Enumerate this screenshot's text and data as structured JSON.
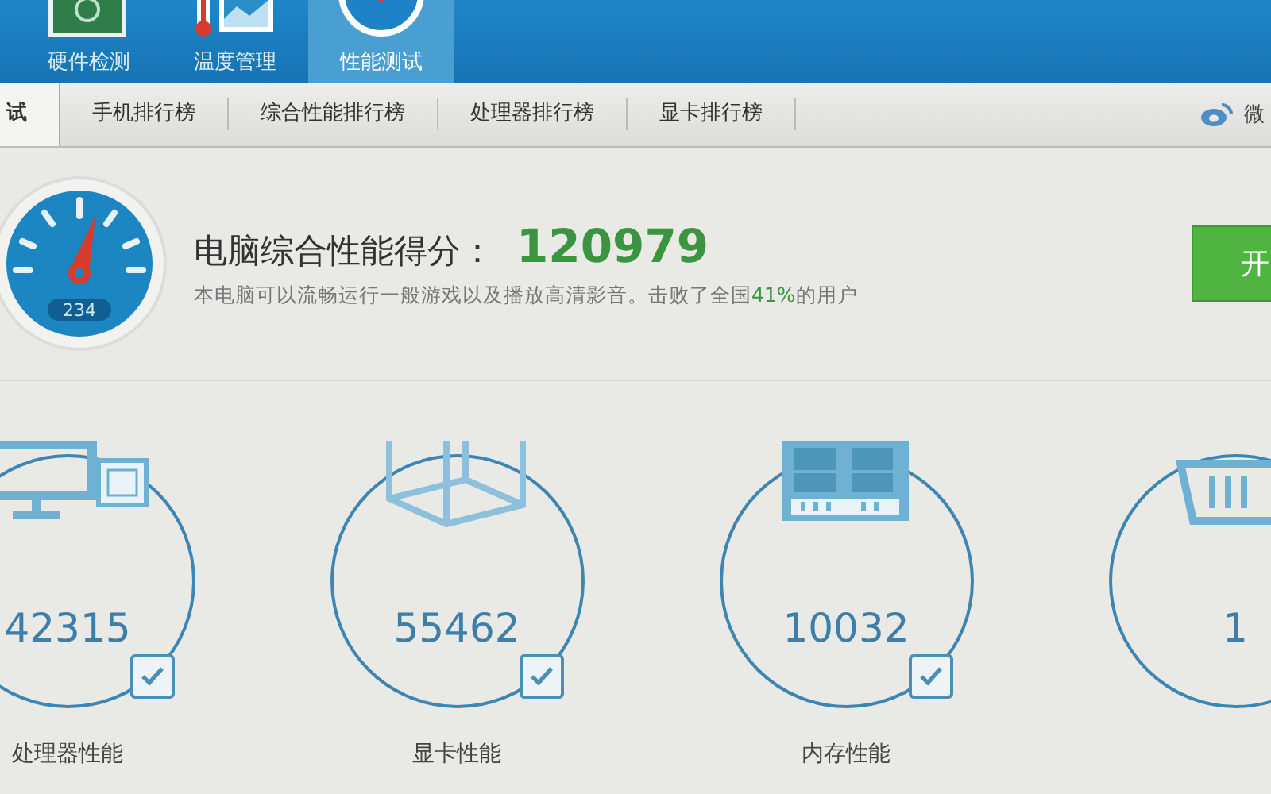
{
  "nav": [
    {
      "label": "硬件检测",
      "kind": "board",
      "selected": false
    },
    {
      "label": "温度管理",
      "kind": "thermo",
      "selected": false
    },
    {
      "label": "性能测试",
      "kind": "gauge",
      "selected": true
    }
  ],
  "tabs": [
    {
      "label": "试",
      "selected": true
    },
    {
      "label": "手机排行榜",
      "selected": false
    },
    {
      "label": "综合性能排行榜",
      "selected": false
    },
    {
      "label": "处理器排行榜",
      "selected": false
    },
    {
      "label": "显卡排行榜",
      "selected": false
    }
  ],
  "share": {
    "label": "微"
  },
  "score": {
    "gauge_reading": "234",
    "title": "电脑综合性能得分：",
    "value": "120979",
    "description": "本电脑可以流畅运行一般游戏以及播放高清影音。击败了全国**41%**的用户",
    "button": "开"
  },
  "parts": [
    {
      "kind": "cpu",
      "score": "42315",
      "label": "处理器性能",
      "checked": true
    },
    {
      "kind": "gpu",
      "score": "55462",
      "label": "显卡性能",
      "checked": true
    },
    {
      "kind": "ram",
      "score": "10032",
      "label": "内存性能",
      "checked": true
    },
    {
      "kind": "disk",
      "score": "1"
    }
  ]
}
